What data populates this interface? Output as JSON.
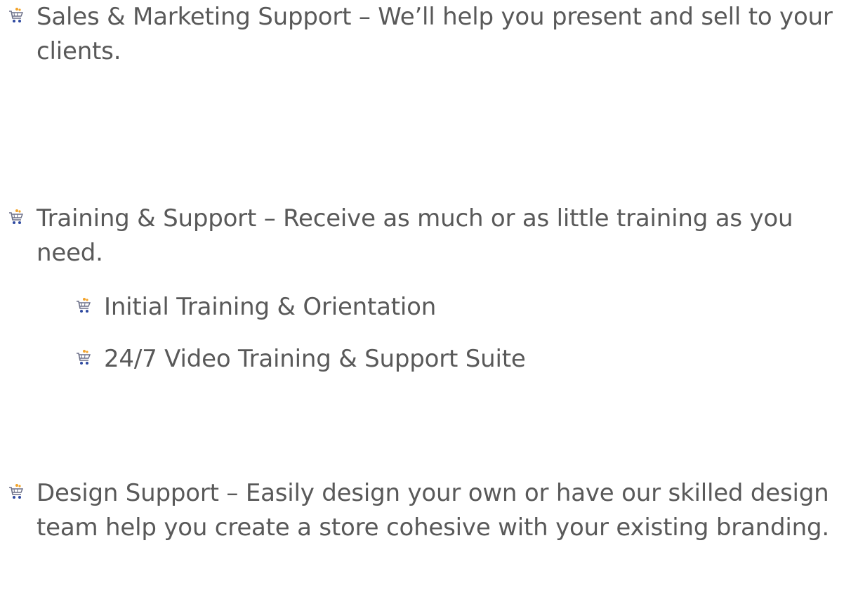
{
  "bullets": [
    {
      "id": "b1",
      "level": 1,
      "icon": "shopping-cart-icon",
      "text": "Sales & Marketing Support – We’ll help you present and sell to your clients."
    },
    {
      "id": "b2",
      "level": 1,
      "icon": "shopping-cart-icon",
      "text": "Training & Support – Receive as much or as little training as you need."
    },
    {
      "id": "b3",
      "level": 2,
      "icon": "shopping-cart-icon",
      "text": "Initial Training & Orientation"
    },
    {
      "id": "b4",
      "level": 2,
      "icon": "shopping-cart-icon",
      "text": "24/7 Video Training & Support Suite"
    },
    {
      "id": "b5",
      "level": 1,
      "icon": "shopping-cart-icon",
      "text": "Design Support – Easily design your own or have our skilled design team help you create a store cohesive with your existing branding."
    }
  ],
  "colors": {
    "text": "#595959",
    "cart_body": "#6b6f87",
    "cart_accent": "#f2a32b",
    "cart_wheel": "#2f4aa0"
  }
}
